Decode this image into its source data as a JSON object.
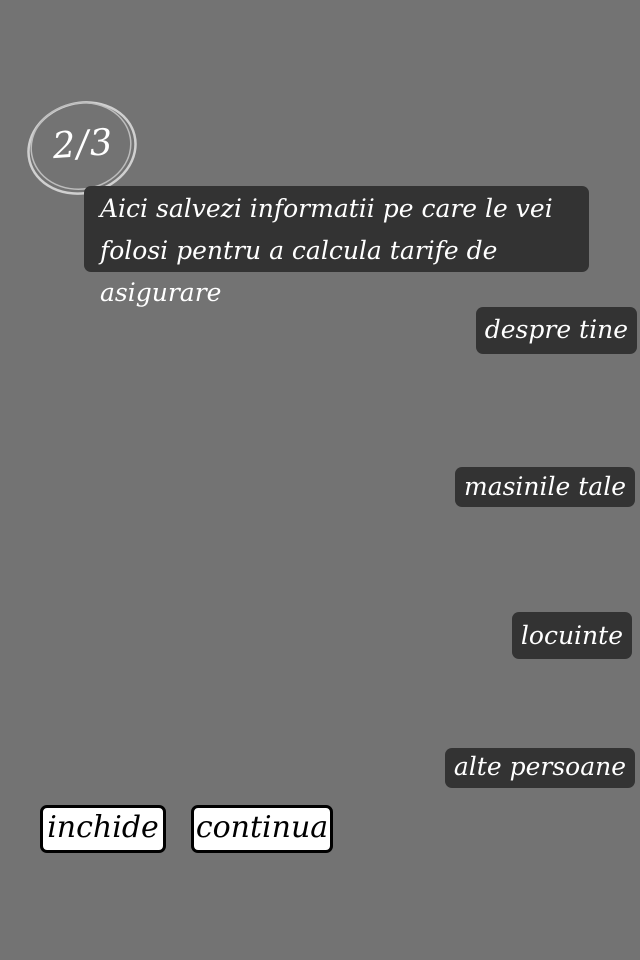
{
  "step": {
    "label": "2/3"
  },
  "tooltip": {
    "line1": "Aici salvezi informatii pe care le vei",
    "line2": "folosi pentru a calcula tarife de asigurare"
  },
  "tags": {
    "about_you": "despre tine",
    "your_cars": "masinile tale",
    "homes": "locuinte",
    "other_people": "alte persoane"
  },
  "buttons": {
    "close": "inchide",
    "next": "continua"
  },
  "colors": {
    "overlay": "#737373",
    "panel": "#333333",
    "text": "#ffffff",
    "button_bg": "#ffffff",
    "button_border": "#000000"
  }
}
